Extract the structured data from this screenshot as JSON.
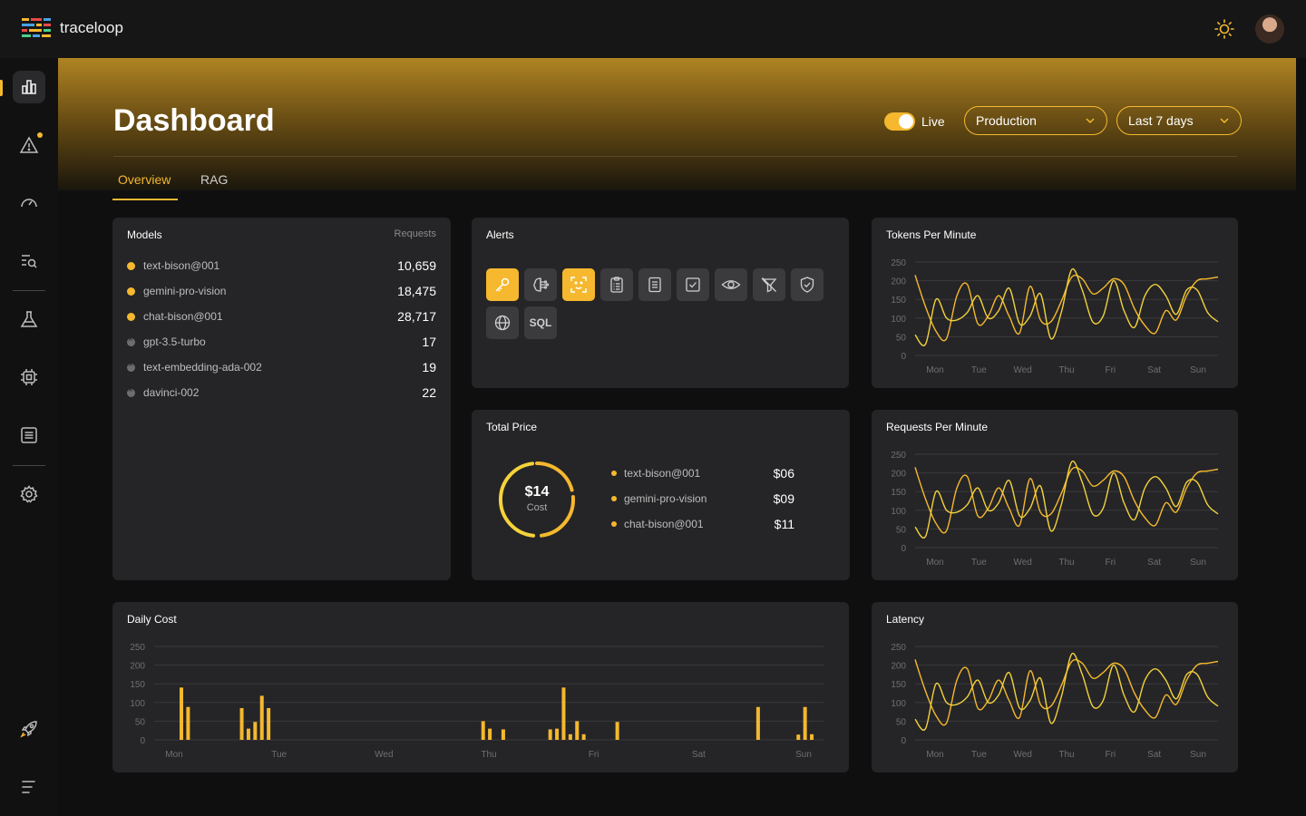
{
  "app": {
    "name": "traceloop"
  },
  "colors": {
    "accent": "#f5b82e",
    "background": "#0f0f10",
    "card": "#252527"
  },
  "header": {
    "theme_icon": "sun-icon",
    "avatar_icon": "user-avatar"
  },
  "sidebar": {
    "items": [
      {
        "name": "dashboard",
        "icon": "bar-chart-icon",
        "active": true
      },
      {
        "name": "alerts",
        "icon": "warning-icon",
        "badge": true
      },
      {
        "name": "performance",
        "icon": "gauge-icon"
      },
      {
        "name": "traces",
        "icon": "search-list-icon"
      },
      {
        "name": "experiments",
        "icon": "flask-icon"
      },
      {
        "name": "models",
        "icon": "chip-icon"
      },
      {
        "name": "documents",
        "icon": "document-icon"
      },
      {
        "name": "settings",
        "icon": "gear-icon"
      },
      {
        "name": "launch",
        "icon": "rocket-icon"
      },
      {
        "name": "menu",
        "icon": "menu-icon"
      }
    ]
  },
  "page": {
    "title": "Dashboard",
    "tabs": [
      {
        "label": "Overview",
        "active": true
      },
      {
        "label": "RAG",
        "active": false
      }
    ],
    "live_label": "Live",
    "live_on": true,
    "environment": "Production",
    "range": "Last 7 days"
  },
  "models": {
    "title": "Models",
    "column": "Requests",
    "rows": [
      {
        "name": "text-bison@001",
        "value": "10,659",
        "active": true
      },
      {
        "name": "gemini-pro-vision",
        "value": "18,475",
        "active": true
      },
      {
        "name": "chat-bison@001",
        "value": "28,717",
        "active": true
      },
      {
        "name": "gpt-3.5-turbo",
        "value": "17",
        "active": false
      },
      {
        "name": "text-embedding-ada-002",
        "value": "19",
        "active": false
      },
      {
        "name": "davinci-002",
        "value": "22",
        "active": false
      }
    ]
  },
  "alerts": {
    "title": "Alerts",
    "icons": [
      {
        "name": "key-icon",
        "active": true
      },
      {
        "name": "brain-icon",
        "active": false
      },
      {
        "name": "face-scan-icon",
        "active": true
      },
      {
        "name": "clipboard-icon",
        "active": false
      },
      {
        "name": "document-lines-icon",
        "active": false
      },
      {
        "name": "checkbox-icon",
        "active": false
      },
      {
        "name": "eye-icon",
        "active": false
      },
      {
        "name": "filter-off-icon",
        "active": false
      },
      {
        "name": "shield-check-icon",
        "active": false
      },
      {
        "name": "globe-icon",
        "active": false
      },
      {
        "name": "sql-icon",
        "active": false,
        "label": "SQL"
      }
    ]
  },
  "total_price": {
    "title": "Total Price",
    "value": "$14",
    "label": "Cost",
    "rows": [
      {
        "name": "text-bison@001",
        "value": "$06"
      },
      {
        "name": "gemini-pro-vision",
        "value": "$09"
      },
      {
        "name": "chat-bison@001",
        "value": "$11"
      }
    ]
  },
  "chart_data": [
    {
      "title": "Tokens Per Minute",
      "type": "line",
      "x": [
        "Mon",
        "Tue",
        "Wed",
        "Thu",
        "Fri",
        "Sat",
        "Sun"
      ],
      "ylim": [
        0,
        250
      ],
      "yticks": [
        0,
        50,
        100,
        150,
        200,
        250
      ],
      "grid": true,
      "series": [
        {
          "values": [
            215,
            130,
            65,
            45,
            160,
            190,
            85,
            105,
            160,
            105,
            60,
            185,
            95,
            90,
            145,
            210,
            205,
            165,
            180,
            205,
            190,
            125,
            80,
            60,
            120,
            95,
            160,
            200,
            205,
            210
          ]
        },
        {
          "values": [
            55,
            30,
            150,
            100,
            95,
            115,
            160,
            100,
            120,
            180,
            85,
            105,
            165,
            45,
            115,
            230,
            175,
            90,
            105,
            200,
            120,
            75,
            160,
            190,
            160,
            110,
            175,
            175,
            115,
            90
          ]
        }
      ]
    },
    {
      "title": "Requests Per Minute",
      "type": "line",
      "x": [
        "Mon",
        "Tue",
        "Wed",
        "Thu",
        "Fri",
        "Sat",
        "Sun"
      ],
      "ylim": [
        0,
        250
      ],
      "yticks": [
        0,
        50,
        100,
        150,
        200,
        250
      ],
      "grid": true,
      "series": [
        {
          "values": [
            215,
            130,
            65,
            45,
            160,
            190,
            85,
            105,
            160,
            105,
            60,
            185,
            95,
            90,
            145,
            210,
            205,
            165,
            180,
            205,
            190,
            125,
            80,
            60,
            120,
            95,
            160,
            200,
            205,
            210
          ]
        },
        {
          "values": [
            55,
            30,
            150,
            100,
            95,
            115,
            160,
            100,
            120,
            180,
            85,
            105,
            165,
            45,
            115,
            230,
            175,
            90,
            105,
            200,
            120,
            75,
            160,
            190,
            160,
            110,
            175,
            175,
            115,
            90
          ]
        }
      ]
    },
    {
      "title": "Daily Cost",
      "type": "bar",
      "x": [
        "Mon",
        "Tue",
        "Wed",
        "Thu",
        "Fri",
        "Sat",
        "Sun"
      ],
      "ylim": [
        0,
        250
      ],
      "yticks": [
        0,
        50,
        100,
        150,
        200,
        250
      ],
      "grid": true,
      "series": [
        {
          "values": [
            140,
            88,
            0,
            0,
            0,
            0,
            0,
            0,
            0,
            85,
            30,
            48,
            118,
            85,
            0,
            0,
            0,
            0,
            0,
            0,
            0,
            0,
            0,
            0,
            0,
            0,
            0,
            0,
            0,
            0,
            0,
            0,
            0,
            0,
            0,
            0,
            0,
            0,
            0,
            0,
            0,
            0,
            0,
            0,
            0,
            50,
            30,
            0,
            28,
            0,
            0,
            0,
            0,
            0,
            0,
            28,
            30,
            140,
            15,
            50,
            15,
            0,
            0,
            0,
            0,
            48,
            0,
            0,
            0,
            0,
            0,
            0,
            0,
            0,
            0,
            0,
            0,
            0,
            0,
            0,
            0,
            0,
            0,
            0,
            0,
            0,
            88,
            0,
            0,
            0,
            0,
            0,
            14,
            88,
            15
          ]
        }
      ]
    },
    {
      "title": "Latency",
      "type": "line",
      "x": [
        "Mon",
        "Tue",
        "Wed",
        "Thu",
        "Fri",
        "Sat",
        "Sun"
      ],
      "ylim": [
        0,
        250
      ],
      "yticks": [
        0,
        50,
        100,
        150,
        200,
        250
      ],
      "grid": true,
      "series": [
        {
          "values": [
            215,
            130,
            65,
            45,
            160,
            190,
            85,
            105,
            160,
            105,
            60,
            185,
            95,
            90,
            145,
            210,
            205,
            165,
            180,
            205,
            190,
            125,
            80,
            60,
            120,
            95,
            160,
            200,
            205,
            210
          ]
        },
        {
          "values": [
            55,
            30,
            150,
            100,
            95,
            115,
            160,
            100,
            120,
            180,
            85,
            105,
            165,
            45,
            115,
            230,
            175,
            90,
            105,
            200,
            120,
            75,
            160,
            190,
            160,
            110,
            175,
            175,
            115,
            90
          ]
        }
      ]
    }
  ]
}
